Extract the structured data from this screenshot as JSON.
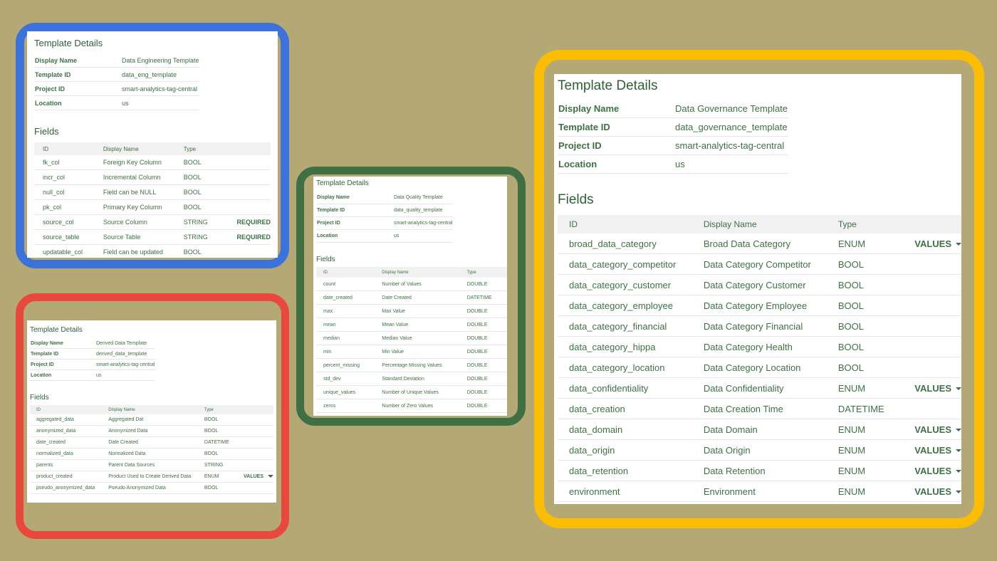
{
  "colors": {
    "background": "#b4a874",
    "blue_frame": "#3b72db",
    "red_frame": "#e8493c",
    "green_frame": "#3f7044",
    "yellow_frame": "#fbbc04",
    "text": "#3f7044"
  },
  "blue": {
    "template_title": "Template Details",
    "details": [
      {
        "key": "Display Name",
        "value": "Data Engineering Template"
      },
      {
        "key": "Template ID",
        "value": "data_eng_template"
      },
      {
        "key": "Project ID",
        "value": "smart-analytics-tag-central"
      },
      {
        "key": "Location",
        "value": "us"
      }
    ],
    "fields_title": "Fields",
    "headers": [
      "ID",
      "Display Name",
      "Type"
    ],
    "rows": [
      {
        "id": "fk_col",
        "name": "Foreign Key Column",
        "type": "BOOL",
        "extra": ""
      },
      {
        "id": "incr_col",
        "name": "Incremental Column",
        "type": "BOOL",
        "extra": ""
      },
      {
        "id": "null_col",
        "name": "Field can be NULL",
        "type": "BOOL",
        "extra": ""
      },
      {
        "id": "pk_col",
        "name": "Primary Key Column",
        "type": "BOOL",
        "extra": ""
      },
      {
        "id": "source_col",
        "name": "Source Column",
        "type": "STRING",
        "extra": "REQUIRED"
      },
      {
        "id": "source_table",
        "name": "Source Table",
        "type": "STRING",
        "extra": "REQUIRED"
      },
      {
        "id": "updatable_col",
        "name": "Field can be updated",
        "type": "BOOL",
        "extra": ""
      }
    ]
  },
  "red": {
    "template_title": "Template Details",
    "details": [
      {
        "key": "Display Name",
        "value": "Derived Data Template"
      },
      {
        "key": "Template ID",
        "value": "derived_data_template"
      },
      {
        "key": "Project ID",
        "value": "smart-analytics-tag-central"
      },
      {
        "key": "Location",
        "value": "us"
      }
    ],
    "fields_title": "Fields",
    "headers": [
      "ID",
      "Display Name",
      "Type"
    ],
    "rows": [
      {
        "id": "aggregated_data",
        "name": "Aggregated Dat",
        "type": "BOOL",
        "extra": ""
      },
      {
        "id": "anonymized_data",
        "name": "Anonymized Data",
        "type": "BOOL",
        "extra": ""
      },
      {
        "id": "date_created",
        "name": "Date Created",
        "type": "DATETIME",
        "extra": ""
      },
      {
        "id": "normalized_data",
        "name": "Normalized Data",
        "type": "BOOL",
        "extra": ""
      },
      {
        "id": "parents",
        "name": "Parent Data Sources",
        "type": "STRING",
        "extra": ""
      },
      {
        "id": "product_created",
        "name": "Product Used to Create Derived Data",
        "type": "ENUM",
        "extra": "VALUES"
      },
      {
        "id": "pseudo_anonymized_data",
        "name": "Pseudo Anonymized Data",
        "type": "BOOL",
        "extra": ""
      }
    ]
  },
  "green": {
    "template_title": "Template Details",
    "details": [
      {
        "key": "Display Name",
        "value": "Data Quality Template"
      },
      {
        "key": "Template ID",
        "value": "data_quality_template"
      },
      {
        "key": "Project ID",
        "value": "smart-analytics-tag-central"
      },
      {
        "key": "Location",
        "value": "us"
      }
    ],
    "fields_title": "Fields",
    "headers": [
      "ID",
      "Display Name",
      "Type"
    ],
    "rows": [
      {
        "id": "count",
        "name": "Number of Values",
        "type": "DOUBLE",
        "extra": ""
      },
      {
        "id": "date_created",
        "name": "Date Created",
        "type": "DATETIME",
        "extra": ""
      },
      {
        "id": "max",
        "name": "Max Value",
        "type": "DOUBLE",
        "extra": ""
      },
      {
        "id": "mean",
        "name": "Mean Value",
        "type": "DOUBLE",
        "extra": ""
      },
      {
        "id": "median",
        "name": "Median Value",
        "type": "DOUBLE",
        "extra": ""
      },
      {
        "id": "min",
        "name": "Min Value",
        "type": "DOUBLE",
        "extra": ""
      },
      {
        "id": "percent_missing",
        "name": "Percentage Missing Values",
        "type": "DOUBLE",
        "extra": ""
      },
      {
        "id": "std_dev",
        "name": "Standard Deviation",
        "type": "DOUBLE",
        "extra": ""
      },
      {
        "id": "unique_values",
        "name": "Number of Unique Values",
        "type": "DOUBLE",
        "extra": ""
      },
      {
        "id": "zeros",
        "name": "Number of Zero Values",
        "type": "DOUBLE",
        "extra": ""
      }
    ]
  },
  "yellow": {
    "template_title": "Template Details",
    "details": [
      {
        "key": "Display Name",
        "value": "Data Governance Template"
      },
      {
        "key": "Template ID",
        "value": "data_governance_template"
      },
      {
        "key": "Project ID",
        "value": "smart-analytics-tag-central"
      },
      {
        "key": "Location",
        "value": "us"
      }
    ],
    "fields_title": "Fields",
    "headers": [
      "ID",
      "Display Name",
      "Type"
    ],
    "rows": [
      {
        "id": "broad_data_category",
        "name": "Broad Data Category",
        "type": "ENUM",
        "extra": "VALUES"
      },
      {
        "id": "data_category_competitor",
        "name": "Data Category Competitor",
        "type": "BOOL",
        "extra": ""
      },
      {
        "id": "data_category_customer",
        "name": "Data Category Customer",
        "type": "BOOL",
        "extra": ""
      },
      {
        "id": "data_category_employee",
        "name": "Data Category Employee",
        "type": "BOOL",
        "extra": ""
      },
      {
        "id": "data_category_financial",
        "name": "Data Category Financial",
        "type": "BOOL",
        "extra": ""
      },
      {
        "id": "data_category_hippa",
        "name": "Data Category Health",
        "type": "BOOL",
        "extra": ""
      },
      {
        "id": "data_category_location",
        "name": "Data Category Location",
        "type": "BOOL",
        "extra": ""
      },
      {
        "id": "data_confidentiality",
        "name": "Data Confidentiality",
        "type": "ENUM",
        "extra": "VALUES"
      },
      {
        "id": "data_creation",
        "name": "Data Creation Time",
        "type": "DATETIME",
        "extra": ""
      },
      {
        "id": "data_domain",
        "name": "Data Domain",
        "type": "ENUM",
        "extra": "VALUES"
      },
      {
        "id": "data_origin",
        "name": "Data Origin",
        "type": "ENUM",
        "extra": "VALUES"
      },
      {
        "id": "data_retention",
        "name": "Data Retention",
        "type": "ENUM",
        "extra": "VALUES"
      },
      {
        "id": "environment",
        "name": "Environment",
        "type": "ENUM",
        "extra": "VALUES"
      }
    ]
  }
}
